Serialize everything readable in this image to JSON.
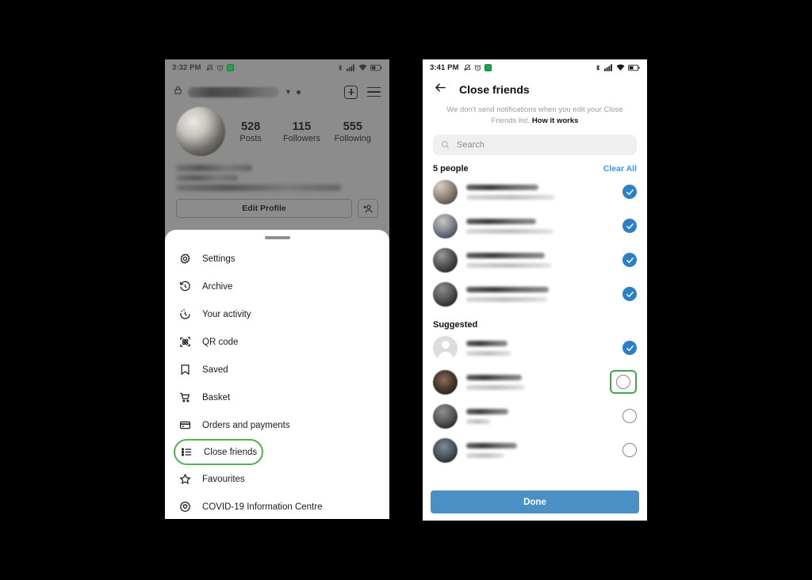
{
  "left_phone": {
    "status_bar": {
      "time": "3:32 PM",
      "icons": [
        "mute-icon",
        "alarm-icon",
        "green-app-icon",
        "bluetooth-icon",
        "signal-icon",
        "wifi-icon",
        "battery-icon"
      ]
    },
    "profile": {
      "lock_icon": "lock-icon",
      "username_redacted": true,
      "add_post_icon": "plus-square-icon",
      "menu_icon": "hamburger-menu-icon",
      "stats": [
        {
          "num": "528",
          "label": "Posts"
        },
        {
          "num": "115",
          "label": "Followers"
        },
        {
          "num": "555",
          "label": "Following"
        }
      ],
      "edit_profile_label": "Edit Profile",
      "add_person_icon": "add-person-icon"
    },
    "sheet_menu": {
      "grabber": "drag-handle",
      "items": [
        {
          "label": "Settings",
          "icon": "gear-icon",
          "highlighted": false
        },
        {
          "label": "Archive",
          "icon": "archive-clock-icon",
          "highlighted": false
        },
        {
          "label": "Your activity",
          "icon": "activity-clock-icon",
          "highlighted": false
        },
        {
          "label": "QR code",
          "icon": "qr-code-icon",
          "highlighted": false
        },
        {
          "label": "Saved",
          "icon": "bookmark-icon",
          "highlighted": false
        },
        {
          "label": "Basket",
          "icon": "shopping-cart-icon",
          "highlighted": false
        },
        {
          "label": "Orders and payments",
          "icon": "credit-card-icon",
          "highlighted": false
        },
        {
          "label": "Close friends",
          "icon": "list-icon",
          "highlighted": true
        },
        {
          "label": "Favourites",
          "icon": "star-icon",
          "highlighted": false
        },
        {
          "label": "COVID-19 Information Centre",
          "icon": "covid-info-icon",
          "highlighted": false
        }
      ]
    }
  },
  "right_phone": {
    "status_bar": {
      "time": "3:41 PM",
      "icons": [
        "mute-icon",
        "alarm-icon",
        "green-app-icon",
        "bluetooth-icon",
        "signal-icon",
        "wifi-icon",
        "battery-icon"
      ]
    },
    "header": {
      "back_icon": "back-arrow-icon",
      "title": "Close friends"
    },
    "subtitle": {
      "text": "We don't send notifications when you edit your Close Friends list. ",
      "link": "How it works"
    },
    "search": {
      "icon": "search-icon",
      "placeholder": "Search",
      "value": ""
    },
    "sections": [
      {
        "title": "5 people",
        "action_label": "Clear All",
        "rows": [
          {
            "avatar": "av1",
            "name_redacted": true,
            "selected": true,
            "highlighted": false
          },
          {
            "avatar": "av2",
            "name_redacted": true,
            "selected": true,
            "highlighted": false
          },
          {
            "avatar": "av3",
            "name_redacted": true,
            "selected": true,
            "highlighted": false
          },
          {
            "avatar": "av4",
            "name_redacted": true,
            "selected": true,
            "highlighted": false
          }
        ]
      },
      {
        "title": "Suggested",
        "action_label": "",
        "rows": [
          {
            "avatar": "av5",
            "name_redacted": true,
            "selected": true,
            "highlighted": false
          },
          {
            "avatar": "av6",
            "name_redacted": true,
            "selected": false,
            "highlighted": true
          },
          {
            "avatar": "av7",
            "name_redacted": true,
            "selected": false,
            "highlighted": false
          },
          {
            "avatar": "av8",
            "name_redacted": true,
            "selected": false,
            "highlighted": false
          }
        ]
      }
    ],
    "done_label": "Done"
  },
  "colors": {
    "accent_blue": "#3897f0",
    "check_blue": "#2b81c7",
    "done_blue": "#4a90c4",
    "highlight_green": "#3faa46",
    "background": "#000000"
  }
}
